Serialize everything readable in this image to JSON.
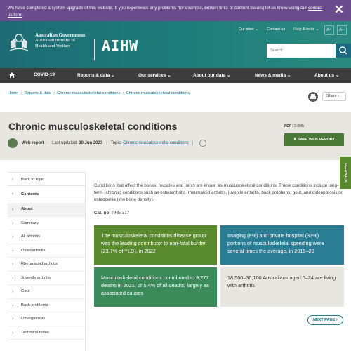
{
  "notice": {
    "text": "We have completed a system upgrade of this website. If you experience any problems (for example, broken links or content issues) let us know using our",
    "link": "contact us form",
    "end": ".",
    "close": "✕"
  },
  "header": {
    "gov_line1": "Australian Government",
    "gov_line2": "Australian Institute of",
    "gov_line3": "Health and Welfare",
    "brand": "AIHW",
    "top_links": [
      "Our sites",
      "Contact us",
      "Help & tools"
    ],
    "font_up": "A+",
    "font_down": "A−",
    "search_placeholder": "Search"
  },
  "nav": {
    "items": [
      "COVID-19",
      "Reports & data",
      "Our services",
      "About our data",
      "News & media",
      "About us"
    ]
  },
  "breadcrumb": [
    "Home",
    "Reports & data",
    "Chronic musculoskeletal conditions",
    "Chronic musculoskeletal conditions"
  ],
  "share_label": "Share",
  "title": "Chronic musculoskeletal conditions",
  "meta": {
    "type": "Web report",
    "updated_label": "Last updated:",
    "updated": "30 Jun 2023",
    "topic_label": "Topic:",
    "topic": "Chronic musculoskeletal conditions"
  },
  "pdf": {
    "label": "PDF",
    "size": "3.6Mb",
    "save": "SAVE WEB REPORT"
  },
  "sidebar": {
    "back": "Back to topic",
    "contents": "Contents",
    "items": [
      "About",
      "Summary",
      "All arthritis",
      "Osteoarthritis",
      "Rheumatoid arthritis",
      "Juvenile arthritis",
      "Gout",
      "Back problems",
      "Osteoporosis",
      "Technical notes"
    ]
  },
  "intro": "Conditions that affect the bones, muscles and joints are known as musculoskeletal conditions. These conditions include long-term (chronic) conditions such as osteoarthritis, rheumatoid arthritis, juvenile arthritis, back problems, gout, and osteoporosis or osteopenia (low bone density).",
  "catno": {
    "label": "Cat. no:",
    "value": "PHE 317"
  },
  "cards": [
    "The musculoskeletal conditions disease group was the leading contributor to non-fatal burden (23.7% of YLD), in 2022",
    "Imaging (8%) and private hospital (33%) portions of musculoskeletal spending were several times the average, in 2019–20",
    "Musculoskeletal conditions contributed to 9,277 deaths in 2021, or 5.4% of all deaths; largely as associated causes",
    "18,500–30,100 Australians aged 0–24 are living with arthritis"
  ],
  "next_page": "NEXT PAGE",
  "feedback": "FEEDBACK",
  "colors": {
    "notice": "#6a4c8c",
    "header": "#1e7c7a",
    "nav": "#3d3d3d",
    "accent_green": "#4a7a36",
    "card_blue": "#2a7d94"
  }
}
